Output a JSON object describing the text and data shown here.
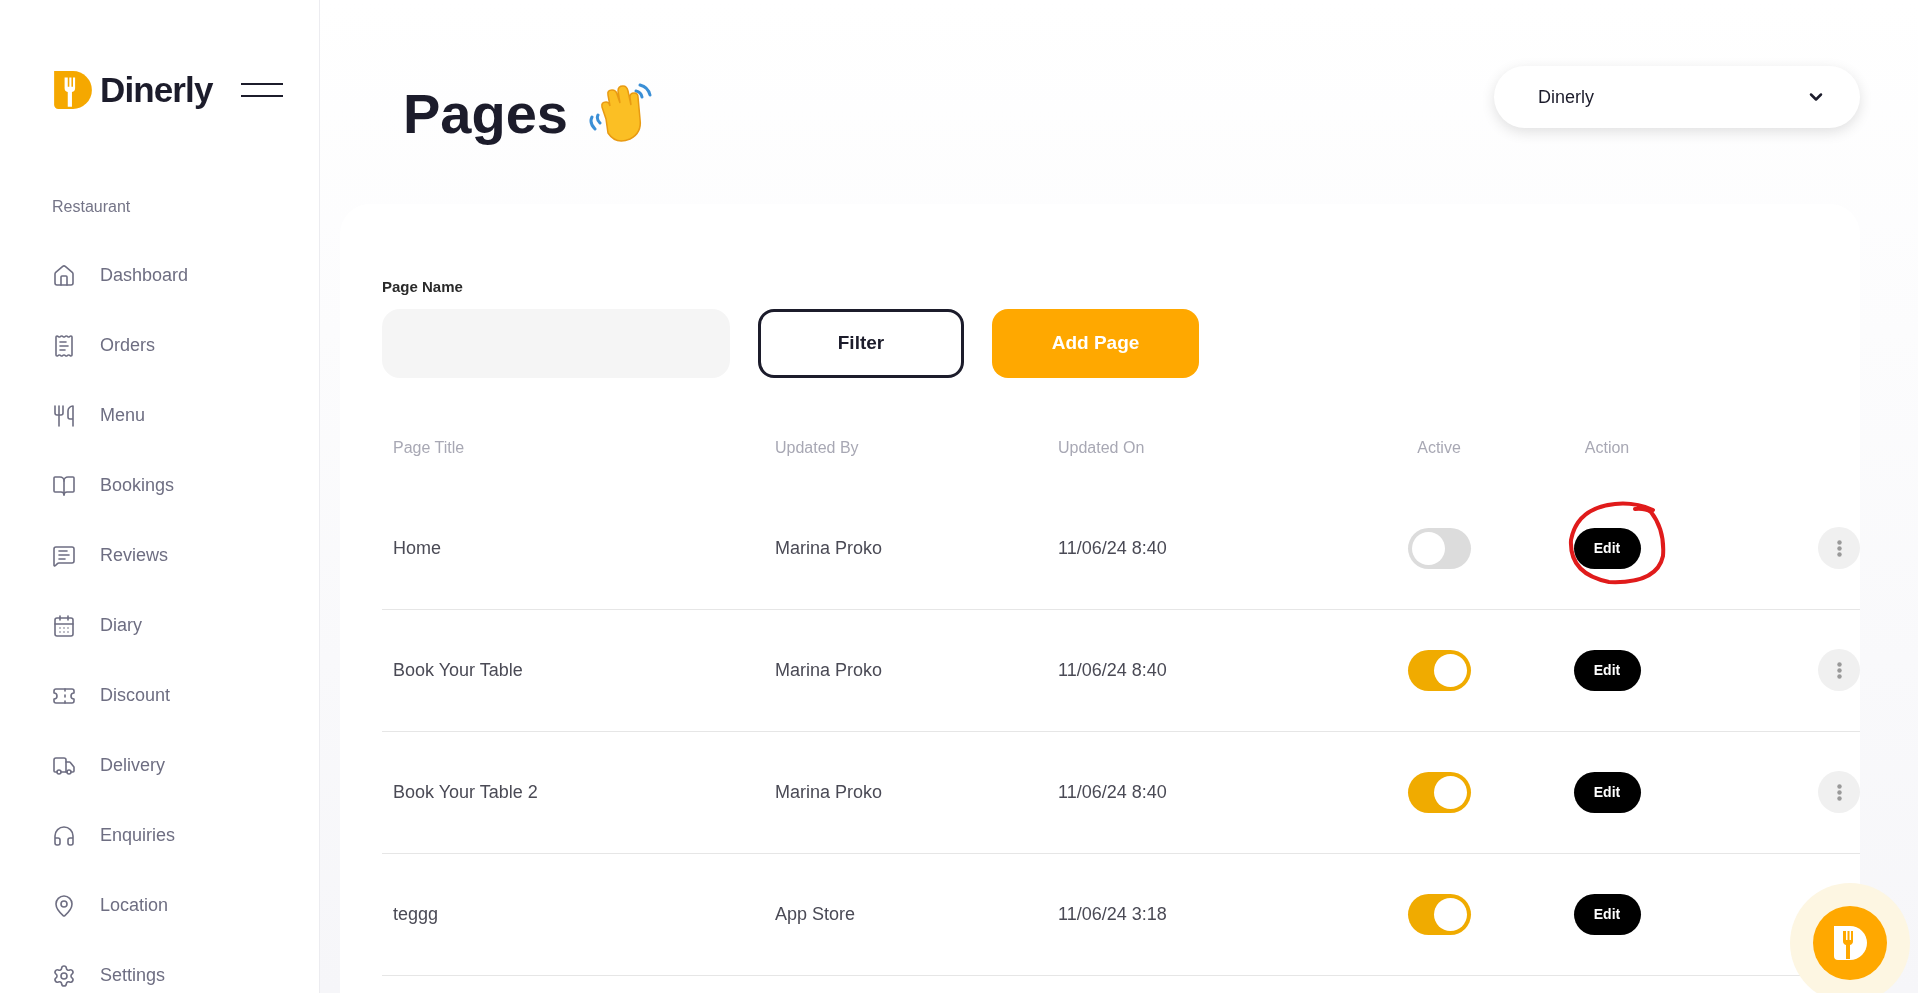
{
  "brand": {
    "name": "Dinerly"
  },
  "sidebar": {
    "section": "Restaurant",
    "items": [
      {
        "label": "Dashboard",
        "kind": "home"
      },
      {
        "label": "Orders",
        "kind": "receipt"
      },
      {
        "label": "Menu",
        "kind": "utensils"
      },
      {
        "label": "Bookings",
        "kind": "book"
      },
      {
        "label": "Reviews",
        "kind": "message"
      },
      {
        "label": "Diary",
        "kind": "calendar"
      },
      {
        "label": "Discount",
        "kind": "ticket"
      },
      {
        "label": "Delivery",
        "kind": "truck"
      },
      {
        "label": "Enquiries",
        "kind": "headphones"
      },
      {
        "label": "Location",
        "kind": "pin"
      },
      {
        "label": "Settings",
        "kind": "gear"
      }
    ]
  },
  "header": {
    "title": "Pages",
    "restaurant_select": "Dinerly"
  },
  "filter": {
    "label": "Page Name",
    "buttons": [
      "Filter",
      "Add Page"
    ]
  },
  "table": {
    "columns": [
      "Page Title",
      "Updated By",
      "Updated On",
      "Active",
      "Action"
    ],
    "rows": [
      {
        "title": "Home",
        "updated_by": "Marina Proko",
        "updated_on": "11/06/24 8:40",
        "active": false,
        "action": "Edit",
        "annotated": true
      },
      {
        "title": "Book Your Table",
        "updated_by": "Marina Proko",
        "updated_on": "11/06/24 8:40",
        "active": true,
        "action": "Edit",
        "annotated": false
      },
      {
        "title": "Book Your Table 2",
        "updated_by": "Marina Proko",
        "updated_on": "11/06/24 8:40",
        "active": true,
        "action": "Edit",
        "annotated": false
      },
      {
        "title": "teggg",
        "updated_by": "App Store",
        "updated_on": "11/06/24 3:18",
        "active": true,
        "action": "Edit",
        "annotated": false
      }
    ]
  }
}
